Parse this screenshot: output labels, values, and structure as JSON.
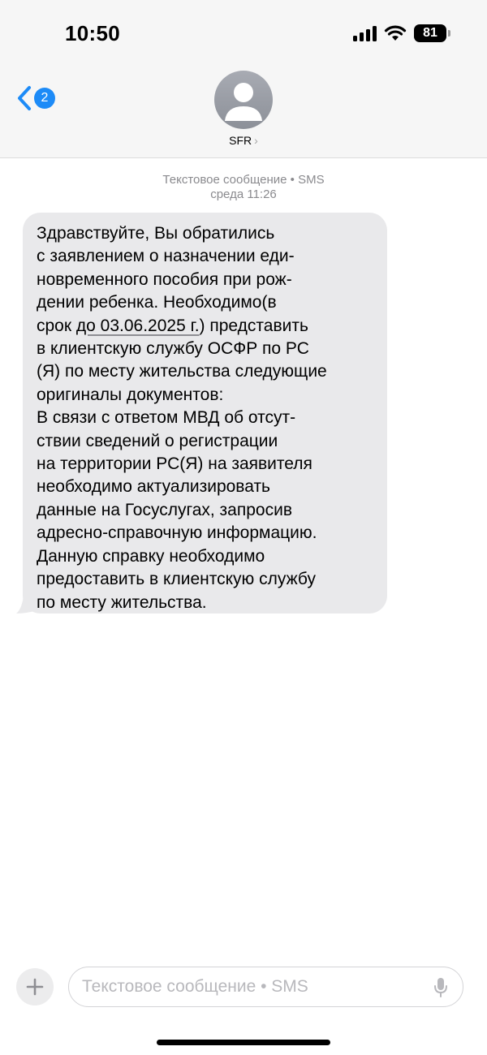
{
  "status_bar": {
    "time": "10:50",
    "battery": "81",
    "icons": [
      "cellular-signal-icon",
      "wifi-icon",
      "battery-icon"
    ]
  },
  "nav": {
    "back_badge": "2",
    "contact_name": "SFR",
    "chevron": "›"
  },
  "message_meta": {
    "type_line": "Текстовое сообщение • SMS",
    "time_line": "среда 11:26"
  },
  "message": {
    "lines": [
      "Здравствуйте, Вы обратились",
      "с заявлением о назначении еди-",
      "новременного пособия при рож-",
      "дении ребенка. Необходимо(в",
      "срок ",
      "до 03.06.2025 г.",
      ") представить",
      "в клиентскую службу ОСФР по РС",
      "(Я) по месту жительства следующие",
      "оригиналы документов:",
      "В связи с ответом МВД об отсут-",
      "ствии сведений о регистрации",
      "на территории РС(Я) на заявителя",
      "необходимо актуализировать",
      "данные на Госуслугах, запросив",
      "адресно-справочную информацию.",
      "Данную справку необходимо",
      "предоставить в клиентскую службу",
      "по месту жительства."
    ]
  },
  "composer": {
    "placeholder": "Текстовое сообщение • SMS"
  },
  "colors": {
    "accent": "#1d8bf7",
    "bubble": "#e9e9eb",
    "meta_text": "#8a8a8e",
    "header_bg": "#f6f6f6"
  }
}
